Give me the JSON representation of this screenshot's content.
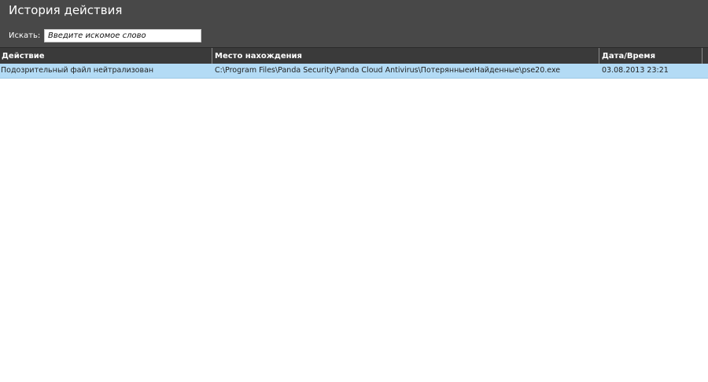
{
  "window": {
    "title": "История действия"
  },
  "search": {
    "label": "Искать:",
    "placeholder": "Введите искомое слово",
    "value": ""
  },
  "table": {
    "columns": [
      "Действие",
      "Место нахождения",
      "Дата/Время"
    ],
    "rows": [
      {
        "action": "Подозрительный файл нейтрализован",
        "location": "C:\\Program Files\\Panda Security\\Panda Cloud Antivirus\\ПотерянныеиНайденные\\pse20.exe",
        "datetime": "03.08.2013 23:21"
      }
    ]
  },
  "colors": {
    "header_bg": "#484848",
    "table_header_bg": "#3a3a3a",
    "selected_row_bg": "#b3dbf5"
  }
}
